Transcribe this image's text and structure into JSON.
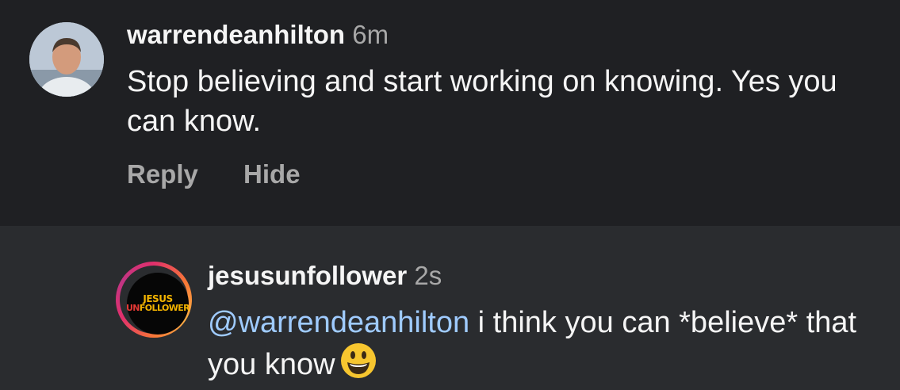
{
  "comment": {
    "username": "warrendeanhilton",
    "time": "6m",
    "text": "Stop believing and start working on knowing. Yes you can know.",
    "actions": {
      "reply_label": "Reply",
      "hide_label": "Hide"
    },
    "avatar_icon": "profile-photo"
  },
  "reply": {
    "username": "jesusunfollower",
    "time": "2s",
    "mention": "@warrendeanhilton",
    "text": " i think you can *believe* that you know",
    "emoji_icon": "grinning-face-emoji",
    "avatar": {
      "logo_line1": "JESUS",
      "logo_line2_prefix": "UN",
      "logo_line2_suffix": "FOLLOWER"
    }
  },
  "colors": {
    "background": "#1f2023",
    "reply_background": "#2a2c2f",
    "text": "#f5f5f5",
    "secondary_text": "#a8a8a8",
    "mention": "#9fcbff",
    "logo_yellow": "#f4b400",
    "logo_red": "#e53935"
  }
}
